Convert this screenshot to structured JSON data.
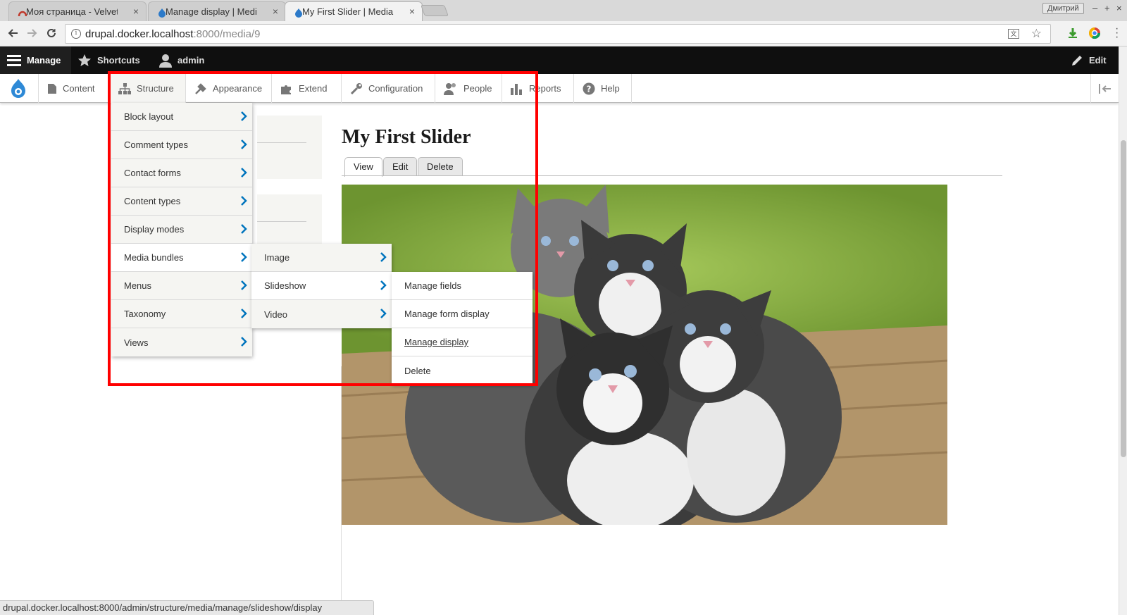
{
  "browser": {
    "tabs": [
      {
        "title": "Моя страница - Velvet",
        "favicon": "velvet-icon",
        "active": false
      },
      {
        "title": "Manage display | Medi",
        "favicon": "drupal-icon",
        "active": false
      },
      {
        "title": "My First Slider | Media",
        "favicon": "drupal-icon",
        "active": true
      }
    ],
    "tab_close": "×",
    "profile_name": "Дмитрий",
    "window_controls": {
      "minimize": "–",
      "maximize": "+",
      "close": "×"
    },
    "url_host": "drupal.docker.localhost",
    "url_rest": ":8000/media/9",
    "status_url": "drupal.docker.localhost:8000/admin/structure/media/manage/slideshow/display"
  },
  "toolbar": {
    "manage": "Manage",
    "shortcuts": "Shortcuts",
    "user": "admin",
    "edit": "Edit"
  },
  "tray": {
    "items": [
      {
        "label": "Content",
        "icon": "content-icon"
      },
      {
        "label": "Structure",
        "icon": "structure-icon"
      },
      {
        "label": "Appearance",
        "icon": "appearance-icon"
      },
      {
        "label": "Extend",
        "icon": "extend-icon"
      },
      {
        "label": "Configuration",
        "icon": "configuration-icon"
      },
      {
        "label": "People",
        "icon": "people-icon"
      },
      {
        "label": "Reports",
        "icon": "reports-icon"
      },
      {
        "label": "Help",
        "icon": "help-icon"
      }
    ]
  },
  "structure_menu": [
    "Block layout",
    "Comment types",
    "Contact forms",
    "Content types",
    "Display modes",
    "Media bundles",
    "Menus",
    "Taxonomy",
    "Views"
  ],
  "media_bundles_menu": [
    "Image",
    "Slideshow",
    "Video"
  ],
  "slideshow_menu": [
    "Manage fields",
    "Manage form display",
    "Manage display",
    "Delete"
  ],
  "page": {
    "title": "My First Slider",
    "tabs": [
      "View",
      "Edit",
      "Delete"
    ],
    "active_tab": "View"
  },
  "colors": {
    "toolbar_bg": "#0f0f0f",
    "tray_bg": "#ffffff",
    "menu_bg": "#f5f5f2",
    "chevron": "#0074bd",
    "highlight": "#ff0000"
  }
}
